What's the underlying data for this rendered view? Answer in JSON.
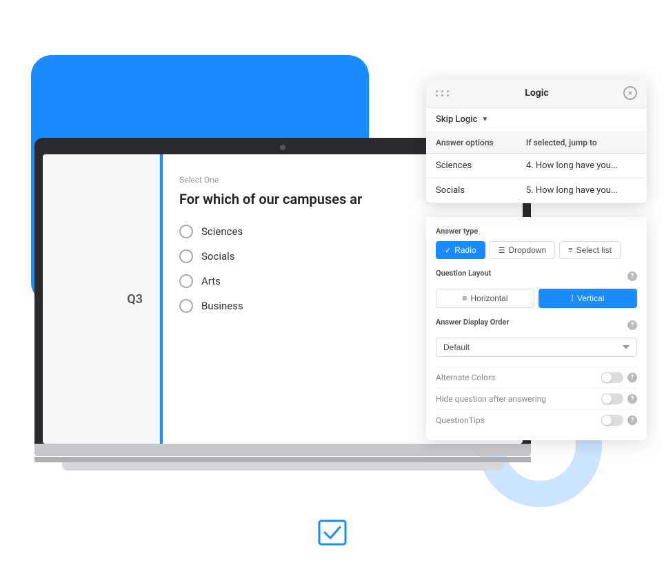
{
  "bg": {
    "blue_rect": true,
    "blue_circle": true
  },
  "survey": {
    "q_number": "Q3",
    "select_one": "Select One",
    "question": "For which of our campuses ar",
    "answers": [
      {
        "id": 1,
        "label": "Sciences"
      },
      {
        "id": 2,
        "label": "Socials"
      },
      {
        "id": 3,
        "label": "Arts"
      },
      {
        "id": 4,
        "label": "Business"
      }
    ]
  },
  "logic_panel": {
    "title": "Logic",
    "close_label": "×",
    "skip_logic_label": "Skip Logic",
    "table": {
      "col1": "Answer options",
      "col2": "If selected, jump to",
      "rows": [
        {
          "answer": "Sciences",
          "jump": "4. How long have you..."
        },
        {
          "answer": "Socials",
          "jump": "5. How long have you..."
        }
      ]
    }
  },
  "settings_panel": {
    "answer_type": {
      "label": "Answer type",
      "options": [
        {
          "id": "radio",
          "label": "Radio",
          "active": true,
          "icon": "✓"
        },
        {
          "id": "dropdown",
          "label": "Dropdown",
          "active": false,
          "icon": "☰"
        },
        {
          "id": "select_list",
          "label": "Select list",
          "active": false,
          "icon": "≡"
        }
      ]
    },
    "question_layout": {
      "label": "Question Layout",
      "options": [
        {
          "id": "horizontal",
          "label": "Horizontal",
          "active": false,
          "icon": "≡"
        },
        {
          "id": "vertical",
          "label": "Vertical",
          "active": true,
          "icon": "⁞⁞⁞"
        }
      ]
    },
    "answer_display_order": {
      "label": "Answer Display Order",
      "selected": "Default"
    },
    "toggles": [
      {
        "id": "alternate_colors",
        "label": "Alternate Colors"
      },
      {
        "id": "hide_after_answering",
        "label": "Hide question after answering"
      },
      {
        "id": "question_tips",
        "label": "QuestionTips"
      }
    ]
  },
  "bottom_icon": {
    "label": "checkbox-icon"
  }
}
